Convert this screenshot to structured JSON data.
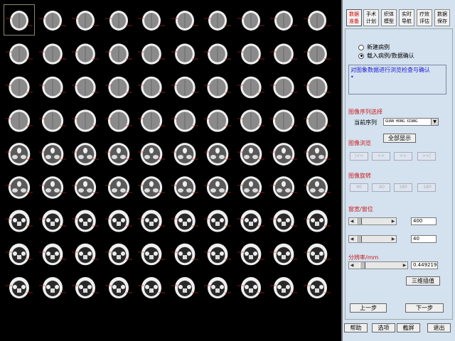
{
  "slices": {
    "total": 90,
    "rows": 9,
    "columns": 10,
    "selected_index": 0
  },
  "tabs": [
    {
      "line1": "数据",
      "line2": "准备",
      "active": true
    },
    {
      "line1": "手术",
      "line2": "计划",
      "active": false
    },
    {
      "line1": "织体",
      "line2": "模型",
      "active": false
    },
    {
      "line1": "实时",
      "line2": "导航",
      "active": false
    },
    {
      "line1": "疗效",
      "line2": "评估",
      "active": false
    },
    {
      "line1": "数据",
      "line2": "保存",
      "active": false
    }
  ],
  "case_options": [
    {
      "label": "新建病例",
      "selected": false
    },
    {
      "label": "载入病例/数据确认",
      "selected": true
    }
  ],
  "message_box": {
    "text": "对图象数据进行浏览检查与确认",
    "marker": "•"
  },
  "series": {
    "section_title": "图像序列选择",
    "current_label": "当前序列",
    "value": "GUAN HONG XIANG",
    "show_all": "全部显示"
  },
  "browse": {
    "section_title": "图像浏览",
    "buttons": [
      "|<<",
      "<<",
      ">>",
      ">>|"
    ]
  },
  "rotate": {
    "section_title": "图像旋转",
    "buttons": [
      "90",
      "-90",
      "180",
      "-180"
    ]
  },
  "window": {
    "section_title": "窗宽/窗位",
    "width_value": "400",
    "level_value": "40",
    "width_level": 0.05,
    "level_level": 0.05
  },
  "resolution": {
    "section_title": "分辨率/mm",
    "value": "0.449219",
    "level": 0.12,
    "interp_button": "三维插值"
  },
  "nav": {
    "prev": "上一步",
    "next": "下一步"
  },
  "bottom": [
    "帮助",
    "选项",
    "截屏",
    "退出"
  ],
  "colors": {
    "panel_bg": "#d4e1ef",
    "section_red": "#c81e1e",
    "message_blue": "#1a1ad0"
  }
}
